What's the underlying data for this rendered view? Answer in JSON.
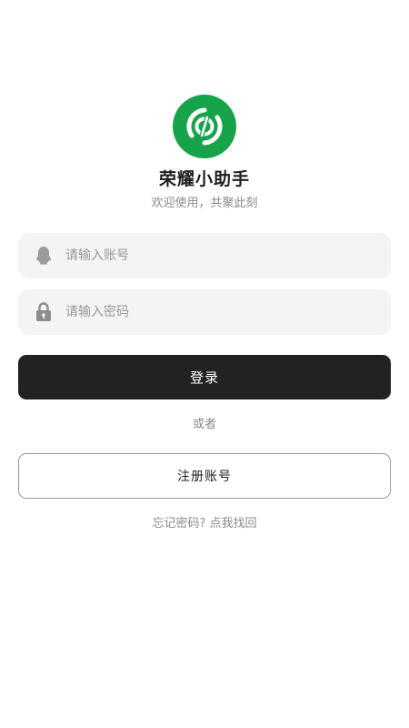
{
  "app": {
    "title": "荣耀小助手",
    "subtitle": "欢迎使用，共聚此刻"
  },
  "form": {
    "account_placeholder": "请输入账号",
    "account_icon": "user-silhouette-icon",
    "password_placeholder": "请输入密码",
    "password_icon": "lock-icon",
    "login_label": "登录",
    "or_label": "或者",
    "register_label": "注册账号",
    "forgot_label": "忘记密码? 点我找回"
  },
  "colors": {
    "logo_green": "#17a34a",
    "button_dark": "#222222",
    "field_bg": "#f4f4f4"
  }
}
